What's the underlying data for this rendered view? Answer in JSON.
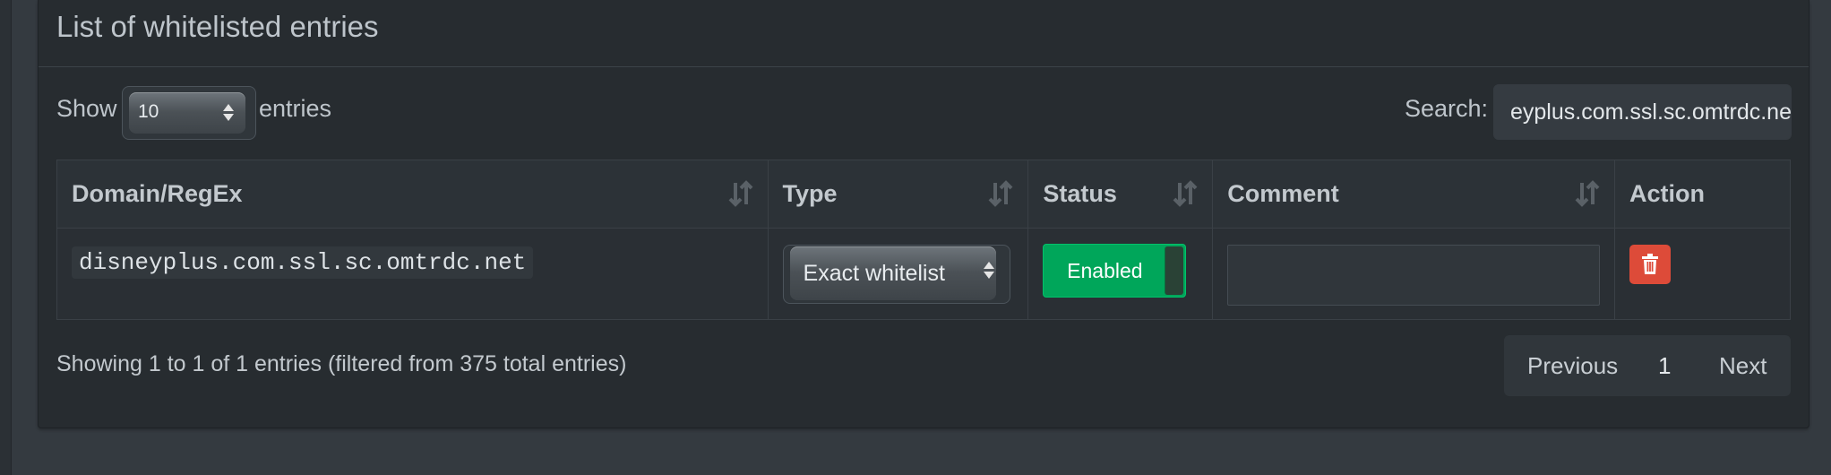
{
  "box": {
    "title": "List of whitelisted entries"
  },
  "length_control": {
    "show_label": "Show",
    "selected": "10",
    "entries_label": "entries"
  },
  "search": {
    "label": "Search:",
    "value": "eyplus.com.ssl.sc.omtrdc.net"
  },
  "table": {
    "columns": [
      "Domain/RegEx",
      "Type",
      "Status",
      "Comment",
      "Action"
    ],
    "rows": [
      {
        "domain": "disneyplus.com.ssl.sc.omtrdc.net",
        "type": "Exact whitelist",
        "status": "Enabled",
        "comment": ""
      }
    ]
  },
  "footer": {
    "info": "Showing 1 to 1 of 1 entries (filtered from 375 total entries)",
    "pagination": {
      "previous": "Previous",
      "page": "1",
      "next": "Next"
    }
  },
  "colors": {
    "background": "#343a40",
    "panel": "#272c30",
    "enabled": "#00a65a",
    "danger": "#dd4b39"
  },
  "icons": [
    "sort-icon",
    "select-arrows-icon",
    "trash-icon"
  ]
}
